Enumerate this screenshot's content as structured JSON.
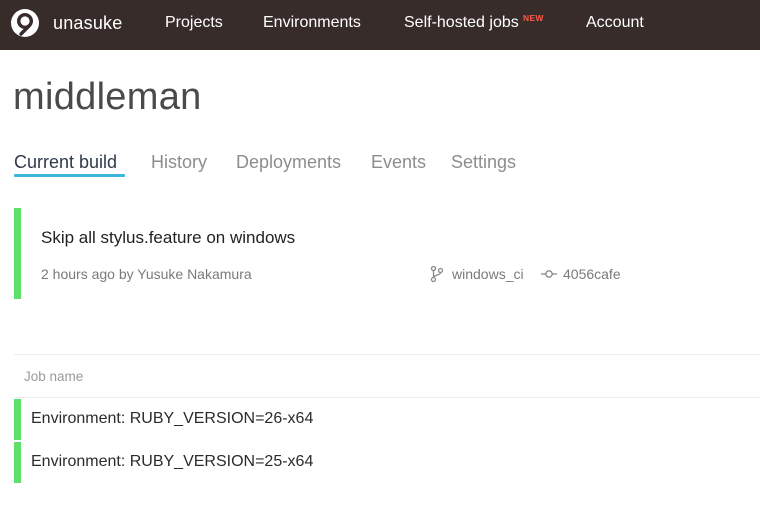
{
  "nav": {
    "brand": "unasuke",
    "items": [
      "Projects",
      "Environments",
      "Self-hosted jobs",
      "Account"
    ],
    "new_badge": "NEW"
  },
  "project": {
    "title": "middleman"
  },
  "tabs": [
    "Current build",
    "History",
    "Deployments",
    "Events",
    "Settings"
  ],
  "build": {
    "message": "Skip all stylus.feature on windows",
    "meta": "2 hours ago by Yusuke Nakamura",
    "branch": "windows_ci",
    "commit": "4056cafe",
    "status_color": "#5fe06a"
  },
  "jobs": {
    "header": "Job name",
    "rows": [
      "Environment: RUBY_VERSION=26-x64",
      "Environment: RUBY_VERSION=25-x64"
    ]
  },
  "colors": {
    "navbar": "#382c2b",
    "accent": "#3ab5dd",
    "success": "#5fe06a",
    "badge": "#ff5b4a"
  },
  "icons": [
    "appveyor-logo-icon",
    "branch-icon",
    "commit-icon"
  ]
}
